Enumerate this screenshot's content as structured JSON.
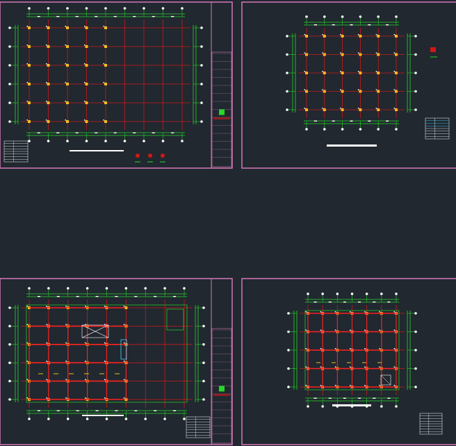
{
  "viewer": {
    "background": "#212830",
    "sheet_border_color": "#d678b8",
    "grid_color": "#d01818",
    "dimension_color": "#26d826",
    "column_color": "#f0c020",
    "node_color": "#ffffff"
  },
  "sheets": [
    {
      "id": "sheet-1",
      "title": "",
      "grid": {
        "cols": 9,
        "rows": 6
      },
      "has_title_block": true,
      "has_legend_table": true
    },
    {
      "id": "sheet-2",
      "title": "",
      "grid": {
        "cols": 6,
        "rows": 5
      },
      "has_title_block": false,
      "has_legend_table": true
    },
    {
      "id": "sheet-3",
      "title": "",
      "grid": {
        "cols": 9,
        "rows": 6
      },
      "has_title_block": true,
      "has_legend_table": true
    },
    {
      "id": "sheet-4",
      "title": "",
      "grid": {
        "cols": 7,
        "rows": 5
      },
      "has_title_block": false,
      "has_legend_table": true
    }
  ]
}
